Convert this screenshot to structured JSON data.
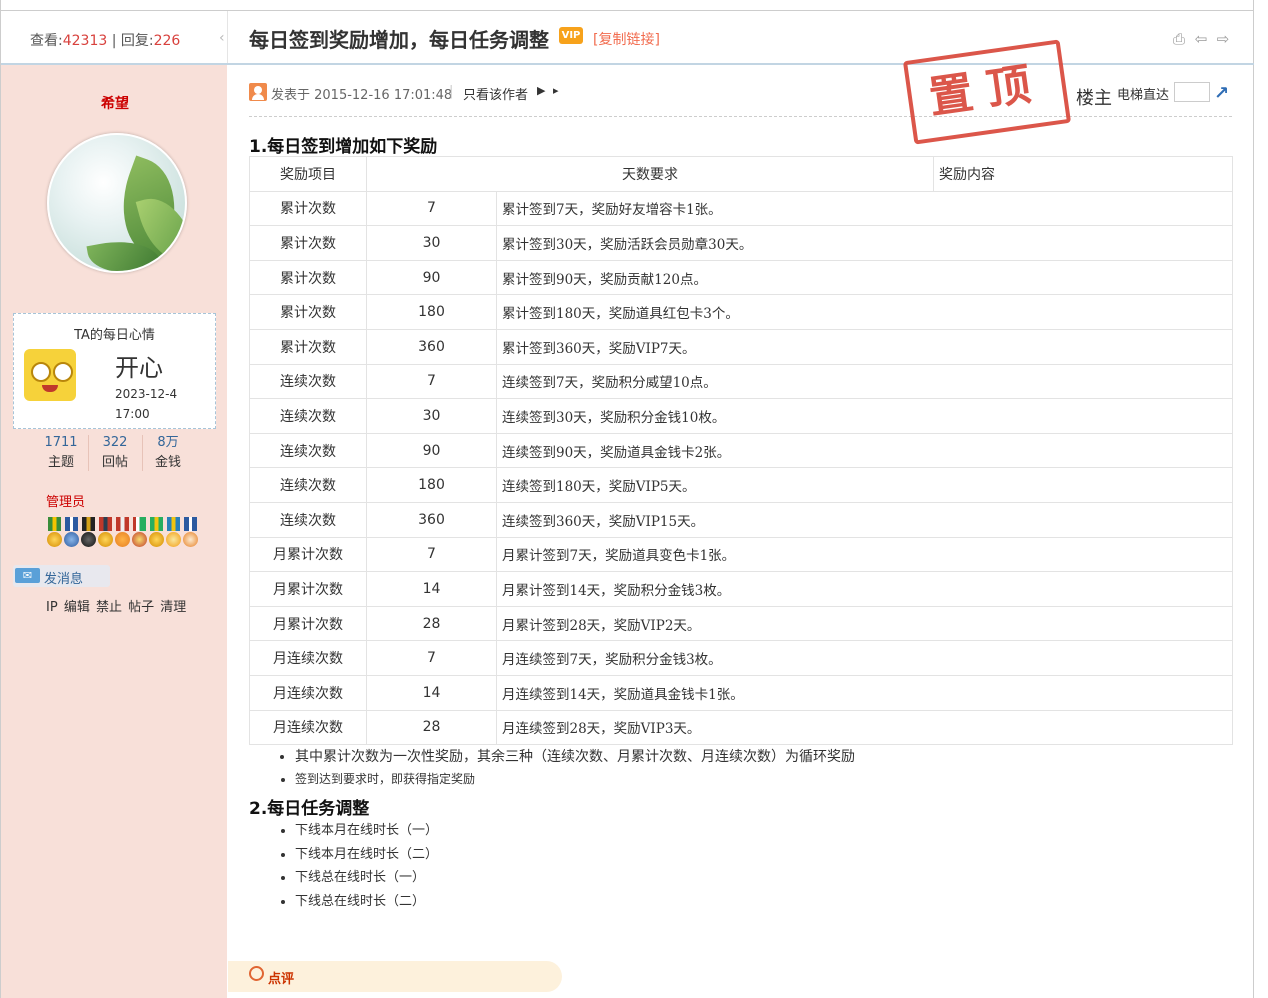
{
  "header": {
    "views_label": "查看:",
    "views": "42313",
    "divider": "|",
    "replies_label": "回复:",
    "replies": "226",
    "title": "每日签到奖励增加，每日任务调整",
    "vip_badge": "VIP",
    "copy_link": "[复制链接]",
    "icons": [
      "print-icon",
      "prev-thread-icon",
      "next-thread-icon"
    ]
  },
  "author": {
    "name": "希望",
    "mood": {
      "title": "TA的每日心情",
      "text": "开心",
      "date": "2023-12-4",
      "time": "17:00"
    },
    "stats": [
      {
        "value": "1711",
        "label": "主题"
      },
      {
        "value": "322",
        "label": "回帖"
      },
      {
        "value": "8万",
        "label": "金钱"
      }
    ],
    "group": "管理员",
    "medal_count": 9,
    "pm": "发消息",
    "admin_links": [
      "IP",
      "编辑",
      "禁止",
      "帖子",
      "清理"
    ]
  },
  "post": {
    "posted": "发表于 2015-12-16 17:01:48",
    "meta_sep": "|",
    "only_author": "只看该作者",
    "stamp": "置顶",
    "floor": "楼主",
    "elevator": "电梯直达",
    "go_icon": "go-icon"
  },
  "section1": {
    "heading": "1.每日签到增加如下奖励",
    "columns": [
      "奖励项目",
      "天数要求",
      "奖励内容"
    ],
    "rows": [
      [
        "累计次数",
        "7",
        "累计签到7天，奖励好友增容卡1张。"
      ],
      [
        "累计次数",
        "30",
        "累计签到30天，奖励活跃会员勋章30天。"
      ],
      [
        "累计次数",
        "90",
        "累计签到90天，奖励贡献120点。"
      ],
      [
        "累计次数",
        "180",
        "累计签到180天，奖励道具红包卡3个。"
      ],
      [
        "累计次数",
        "360",
        "累计签到360天，奖励VIP7天。"
      ],
      [
        "连续次数",
        "7",
        "连续签到7天，奖励积分威望10点。"
      ],
      [
        "连续次数",
        "30",
        "连续签到30天，奖励积分金钱10枚。"
      ],
      [
        "连续次数",
        "90",
        "连续签到90天，奖励道具金钱卡2张。"
      ],
      [
        "连续次数",
        "180",
        "连续签到180天，奖励VIP5天。"
      ],
      [
        "连续次数",
        "360",
        "连续签到360天，奖励VIP15天。"
      ],
      [
        "月累计次数",
        "7",
        "月累计签到7天，奖励道具变色卡1张。"
      ],
      [
        "月累计次数",
        "14",
        "月累计签到14天，奖励积分金钱3枚。"
      ],
      [
        "月累计次数",
        "28",
        "月累计签到28天，奖励VIP2天。"
      ],
      [
        "月连续次数",
        "7",
        "月连续签到7天，奖励积分金钱3枚。"
      ],
      [
        "月连续次数",
        "14",
        "月连续签到14天，奖励道具金钱卡1张。"
      ],
      [
        "月连续次数",
        "28",
        "月连续签到28天，奖励VIP3天。"
      ]
    ],
    "notes": [
      "其中累计次数为一次性奖励，其余三种（连续次数、月累计次数、月连续次数）为循环奖励",
      "签到达到要求时，即获得指定奖励"
    ]
  },
  "section2": {
    "heading": "2.每日任务调整",
    "items": [
      "下线本月在线时长（一）",
      "下线本月在线时长（二）",
      "下线总在线时长（一）",
      "下线总在线时长（二）"
    ]
  },
  "footer": {
    "comment": "点评"
  }
}
